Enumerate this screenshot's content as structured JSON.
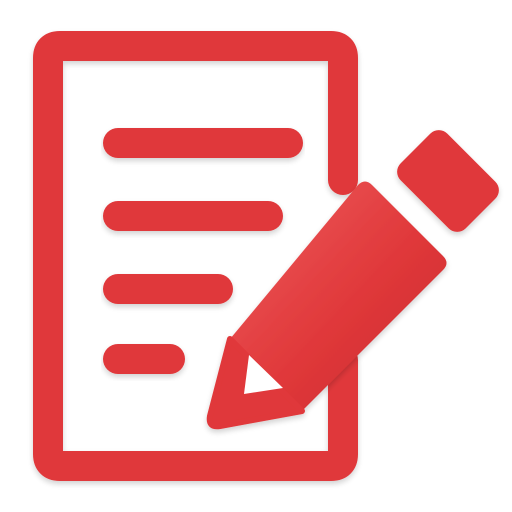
{
  "icon": {
    "name": "edit-document-icon",
    "colors": {
      "primary": "#E0383A",
      "highlight": "#EE5C5D",
      "shadow": "#B32427",
      "background": "#FFFFFF"
    },
    "text_lines": 4
  }
}
